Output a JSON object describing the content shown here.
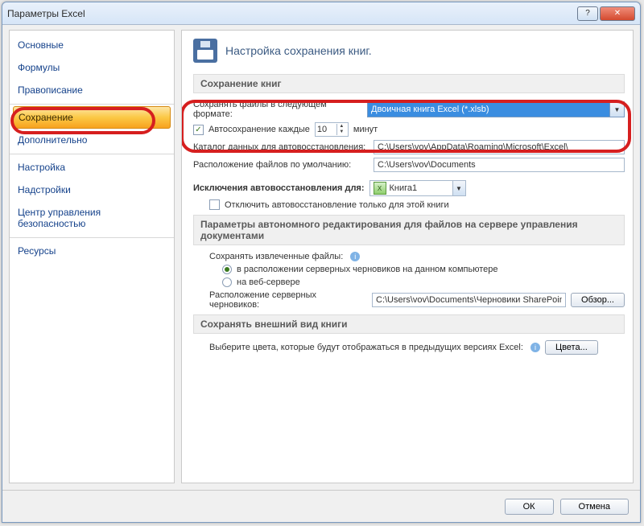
{
  "window": {
    "title": "Параметры Excel"
  },
  "sidebar": {
    "items": [
      {
        "label": "Основные"
      },
      {
        "label": "Формулы"
      },
      {
        "label": "Правописание"
      },
      {
        "label": "Сохранение"
      },
      {
        "label": "Дополнительно"
      },
      {
        "label": "Настройка"
      },
      {
        "label": "Надстройки"
      },
      {
        "label": "Центр управления безопасностью"
      },
      {
        "label": "Ресурсы"
      }
    ]
  },
  "header": {
    "title": "Настройка сохранения книг."
  },
  "sections": {
    "save_books": "Сохранение книг",
    "offline_edit": "Параметры автономного редактирования для файлов на сервере управления документами",
    "preserve_look": "Сохранять внешний вид книги"
  },
  "save": {
    "format_label": "Сохранять файлы в следующем формате:",
    "format_value": "Двоичная книга Excel (*.xlsb)",
    "autosave_prefix": "Автосохранение каждые",
    "autosave_value": "10",
    "autosave_suffix": "минут",
    "recovery_dir_label": "Каталог данных для автовосстановления:",
    "recovery_dir_value": "C:\\Users\\vov\\AppData\\Roaming\\Microsoft\\Excel\\",
    "default_loc_label": "Расположение файлов по умолчанию:",
    "default_loc_value": "C:\\Users\\vov\\Documents"
  },
  "exclude": {
    "label": "Исключения автовосстановления для:",
    "book": "Книга1",
    "disable_label": "Отключить автовосстановление только для этой книги"
  },
  "offline": {
    "keep_label": "Сохранять извлеченные файлы:",
    "opt_local": "в расположении серверных черновиков на данном компьютере",
    "opt_web": "на веб-сервере",
    "drafts_label": "Расположение серверных черновиков:",
    "drafts_value": "C:\\Users\\vov\\Documents\\Черновики SharePoin",
    "browse": "Обзор..."
  },
  "look": {
    "desc": "Выберите цвета, которые будут отображаться в предыдущих версиях Excel:",
    "colors_btn": "Цвета..."
  },
  "footer": {
    "ok": "ОК",
    "cancel": "Отмена"
  }
}
